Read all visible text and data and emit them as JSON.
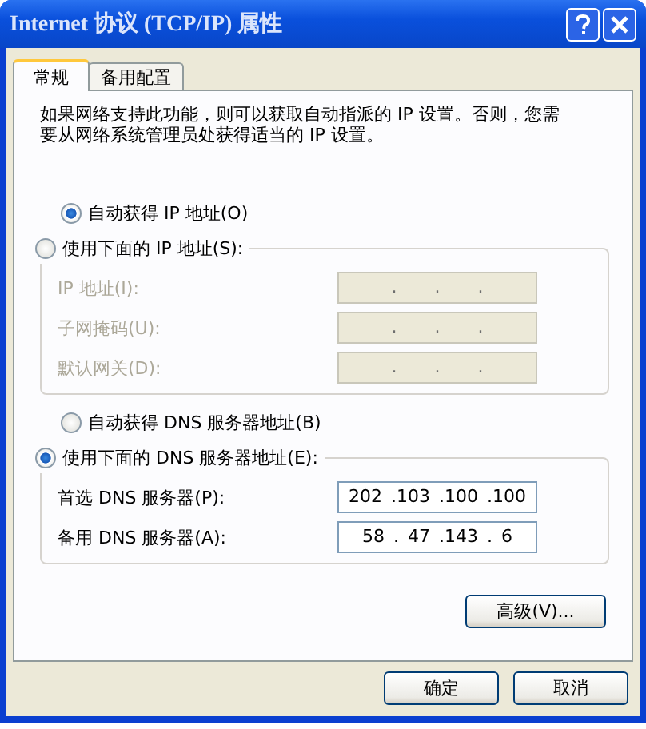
{
  "window": {
    "title": "Internet 协议 (TCP/IP) 属性"
  },
  "tabs": [
    {
      "label": "常规",
      "selected": true
    },
    {
      "label": "备用配置",
      "selected": false
    }
  ],
  "description": "如果网络支持此功能，则可以获取自动指派的 IP 设置。否则，您需要从网络系统管理员处获得适当的 IP 设置。",
  "ip_section": {
    "options": [
      {
        "label": "自动获得 IP 地址(O)",
        "selected": true
      },
      {
        "label": "使用下面的 IP 地址(S):",
        "selected": false
      }
    ],
    "fields": [
      {
        "label": "IP 地址(I):",
        "value": ". . .",
        "disabled": true
      },
      {
        "label": "子网掩码(U):",
        "value": ". . .",
        "disabled": true
      },
      {
        "label": "默认网关(D):",
        "value": ". . .",
        "disabled": true
      }
    ]
  },
  "dns_section": {
    "options": [
      {
        "label": "自动获得 DNS 服务器地址(B)",
        "selected": false
      },
      {
        "label": "使用下面的 DNS 服务器地址(E):",
        "selected": true
      }
    ],
    "fields": [
      {
        "label": "首选 DNS 服务器(P):",
        "value": "202 .103 .100 .100",
        "disabled": false
      },
      {
        "label": "备用 DNS 服务器(A):",
        "value": "58 . 47 .143 . 6",
        "disabled": false
      }
    ]
  },
  "advanced_button": "高级(V)...",
  "buttons": [
    "确定",
    "取消"
  ]
}
